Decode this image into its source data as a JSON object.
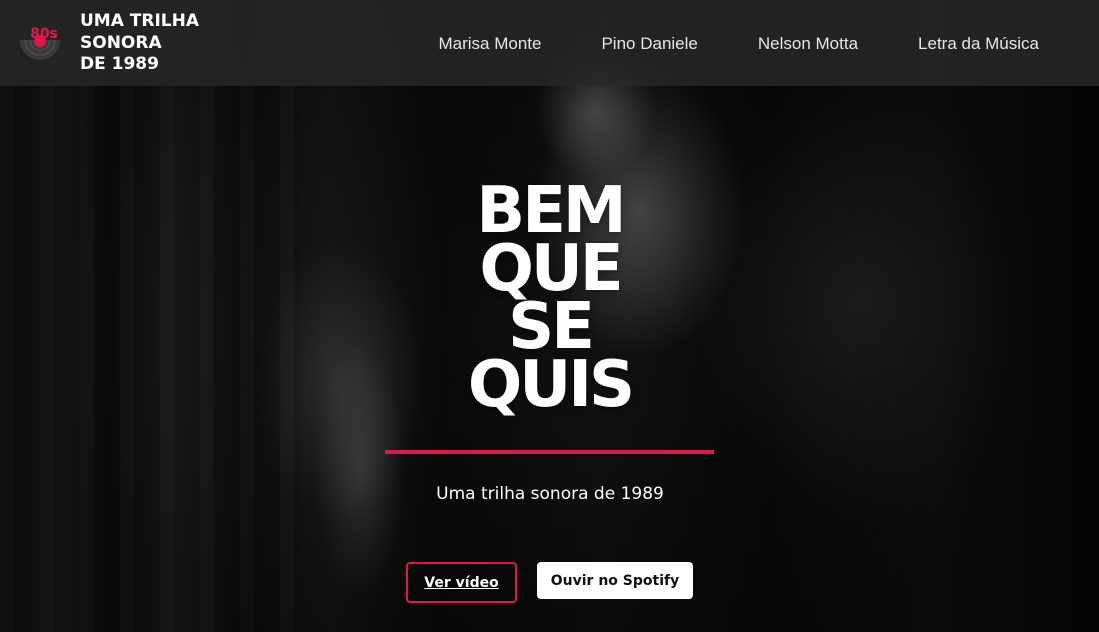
{
  "header": {
    "logo_text": "80s",
    "title_lines": [
      "UMA TRILHA",
      "SONORA",
      "DE 1989"
    ],
    "nav": [
      "Marisa Monte",
      "Pino Daniele",
      "Nelson Motta",
      "Letra da Música"
    ]
  },
  "hero": {
    "headline_lines": [
      "BEM",
      "QUE",
      "SE",
      "QUIS"
    ],
    "subtitle": "Uma trilha sonora de 1989",
    "buttons": {
      "video": "Ver vídeo",
      "spotify": "Ouvir no Spotify"
    }
  },
  "colors": {
    "accent": "#e0174a",
    "navbar_bg": "#282828"
  },
  "icons": {
    "logo": "vinyl-record-icon"
  }
}
